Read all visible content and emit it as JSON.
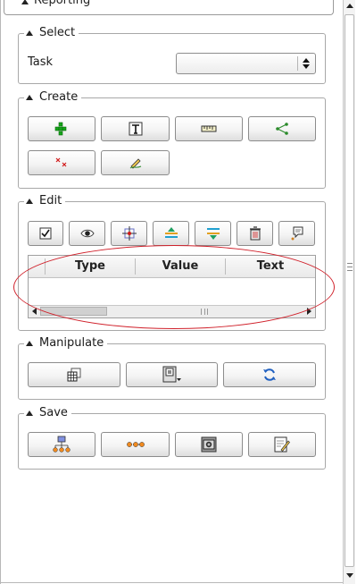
{
  "panel": {
    "reporting": {
      "title": "Reporting"
    },
    "select": {
      "title": "Select",
      "task_label": "Task",
      "task_value": ""
    },
    "create": {
      "title": "Create"
    },
    "edit": {
      "title": "Edit",
      "table": {
        "columns": [
          "Type",
          "Value",
          "Text"
        ],
        "rows": []
      }
    },
    "manipulate": {
      "title": "Manipulate"
    },
    "save": {
      "title": "Save"
    }
  },
  "icons": {
    "create": [
      "green-network-icon",
      "text-box-icon",
      "ruler-icon",
      "share-nodes-icon",
      "red-points-icon",
      "pencil-draw-icon"
    ],
    "edit": [
      "checkbox-icon",
      "eye-icon",
      "crosshair-icon",
      "move-up-icon",
      "move-down-icon",
      "trash-icon",
      "comment-icon"
    ],
    "manipulate": [
      "grid-layers-icon",
      "device-dropdown-icon",
      "refresh-icon"
    ],
    "save": [
      "hierarchy-icon",
      "link-chain-icon",
      "camera-icon",
      "notepad-edit-icon"
    ]
  },
  "colors": {
    "highlight": "#d0202a",
    "accent_green": "#16a51a",
    "accent_blue": "#2060c0"
  }
}
